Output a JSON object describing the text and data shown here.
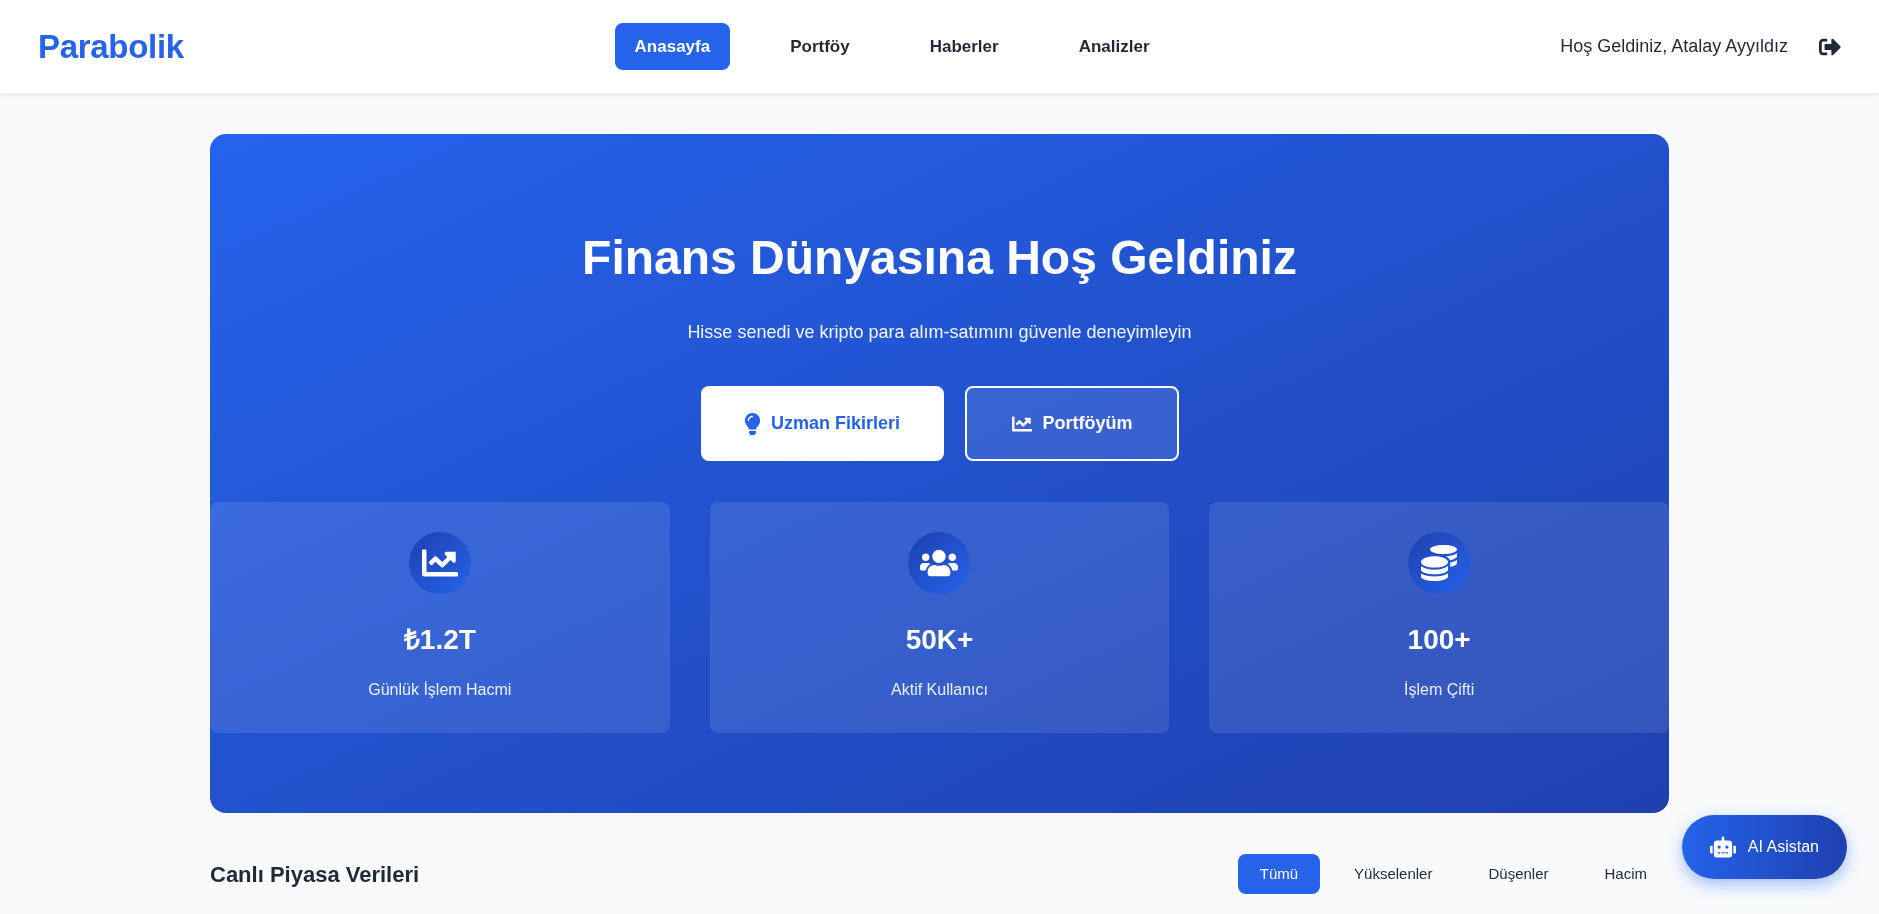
{
  "header": {
    "logo": "Parabolik",
    "nav": [
      {
        "label": "Anasayfa",
        "selected": true
      },
      {
        "label": "Portföy",
        "selected": false
      },
      {
        "label": "Haberler",
        "selected": false
      },
      {
        "label": "Analizler",
        "selected": false
      }
    ],
    "greeting": "Hoş Geldiniz, Atalay Ayyıldız"
  },
  "hero": {
    "title": "Finans Dünyasına Hoş Geldiniz",
    "subtitle": "Hisse senedi ve kripto para alım-satımını güvenle deneyimleyin",
    "buttons": [
      {
        "label": "Uzman Fikirleri",
        "kind": "solid"
      },
      {
        "label": "Portföyüm",
        "kind": "outline"
      }
    ],
    "stats": [
      {
        "value": "₺1.2T",
        "label": "Günlük İşlem Hacmi"
      },
      {
        "value": "50K+",
        "label": "Aktif Kullanıcı"
      },
      {
        "value": "100+",
        "label": "İşlem Çifti"
      }
    ]
  },
  "market": {
    "title": "Canlı Piyasa Verileri",
    "tabs": [
      {
        "label": "Tümü",
        "selected": true
      },
      {
        "label": "Yükselenler",
        "selected": false
      },
      {
        "label": "Düşenler",
        "selected": false
      },
      {
        "label": "Hacim",
        "selected": false
      }
    ]
  },
  "assistant_button": {
    "label": "AI Asistan"
  }
}
